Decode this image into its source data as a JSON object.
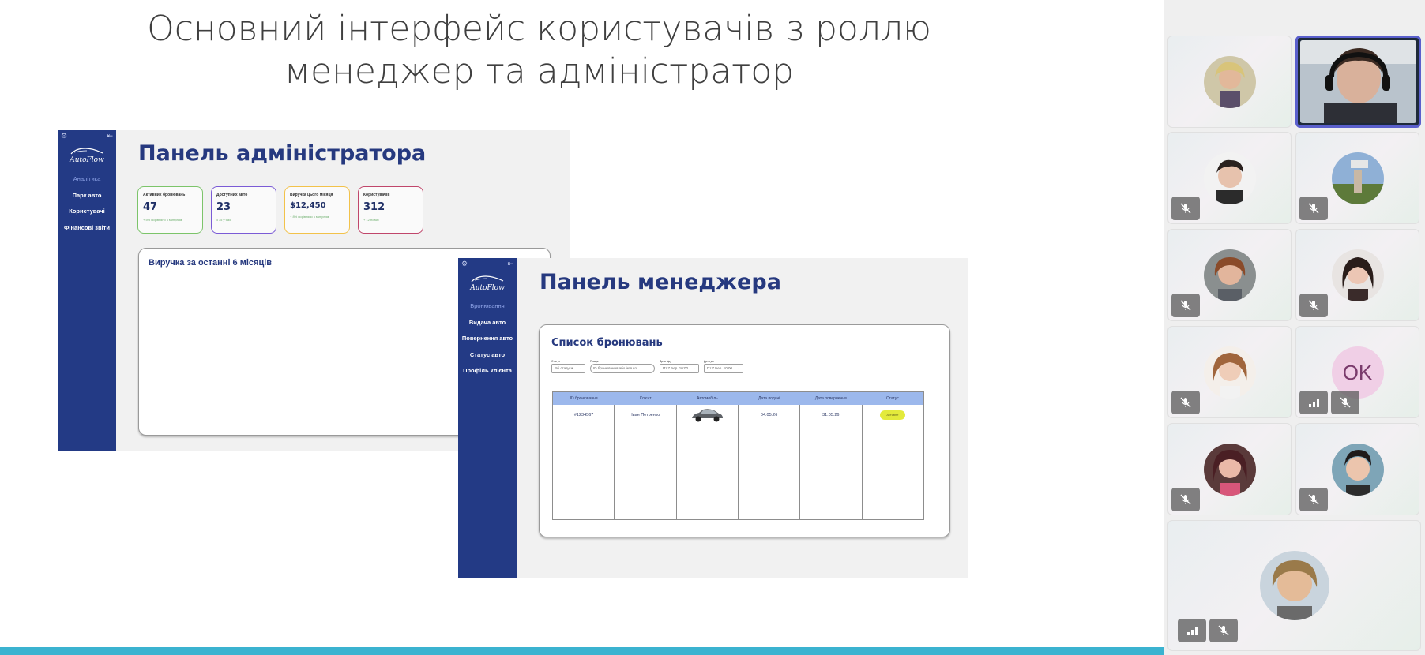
{
  "slide": {
    "title_line1": "Основний інтерфейс користувачів з роллю",
    "title_line2": "менеджер та адміністратор"
  },
  "admin_panel": {
    "brand": "AutoFlow",
    "heading": "Панель адміністратора",
    "nav": [
      "Аналітика",
      "Парк авто",
      "Користувачі",
      "Фінансові звіти"
    ],
    "stats": [
      {
        "label": "Активних бронювань",
        "value": "47",
        "sub": "+ 5% порівняно з минулим"
      },
      {
        "label": "Доступних авто",
        "value": "23",
        "sub": "з 35 у базі"
      },
      {
        "label": "Виручка цього місяця",
        "value": "$12,450",
        "sub": "+ 8% порівняно з минулим"
      },
      {
        "label": "Користувачів",
        "value": "312",
        "sub": "+ 12 нових"
      }
    ],
    "revenue_title": "Виручка за останні 6 місяців",
    "stat_colors": [
      "#7cc46a",
      "#7b5bd6",
      "#f2c24a",
      "#c0466b"
    ]
  },
  "manager_panel": {
    "brand": "AutoFlow",
    "heading": "Панель менеджера",
    "nav": [
      "Бронювання",
      "Видача авто",
      "Повернення авто",
      "Статус авто",
      "Профіль клієнта"
    ],
    "list_title": "Список бронювань",
    "filters": [
      {
        "label": "Статус",
        "value": "Всі статуси"
      },
      {
        "label": "Пошук",
        "value": "ID бронювання або ім'я кл"
      },
      {
        "label": "Дата від",
        "value": "Пт 7 Бер. 10:00"
      },
      {
        "label": "Дата до",
        "value": "Пт 7 Бер. 10:00"
      }
    ],
    "columns": [
      "ID бронювання",
      "Клієнт",
      "Автомобіль",
      "Дата подачі",
      "Дата повернення",
      "Статус"
    ],
    "rows": [
      {
        "id": "#1234567",
        "client": "Іван Петренко",
        "car": "car-image",
        "start": "04.05.26",
        "end": "31.05.26",
        "status": "Активне"
      }
    ]
  },
  "participants": {
    "tiles": [
      {
        "name": "participant-1",
        "muted": false,
        "speaking": false,
        "initials": ""
      },
      {
        "name": "participant-speaker",
        "muted": false,
        "speaking": true,
        "initials": ""
      },
      {
        "name": "participant-3",
        "muted": true,
        "speaking": false,
        "initials": ""
      },
      {
        "name": "participant-4",
        "muted": true,
        "speaking": false,
        "initials": ""
      },
      {
        "name": "participant-5",
        "muted": true,
        "speaking": false,
        "initials": ""
      },
      {
        "name": "participant-6",
        "muted": true,
        "speaking": false,
        "initials": ""
      },
      {
        "name": "participant-7",
        "muted": true,
        "speaking": false,
        "initials": ""
      },
      {
        "name": "participant-ok",
        "muted": true,
        "speaking": false,
        "initials": "OK"
      },
      {
        "name": "participant-9",
        "muted": true,
        "speaking": false,
        "initials": ""
      },
      {
        "name": "participant-10",
        "muted": true,
        "speaking": false,
        "initials": ""
      },
      {
        "name": "participant-11",
        "muted": true,
        "speaking": false,
        "initials": ""
      }
    ]
  },
  "colors": {
    "sidebar": "#233a85",
    "heading": "#26397f",
    "accent_bar": "#3bb3d0",
    "speaking_border": "#5a5fcc",
    "status_active": "#e3ea3b"
  }
}
